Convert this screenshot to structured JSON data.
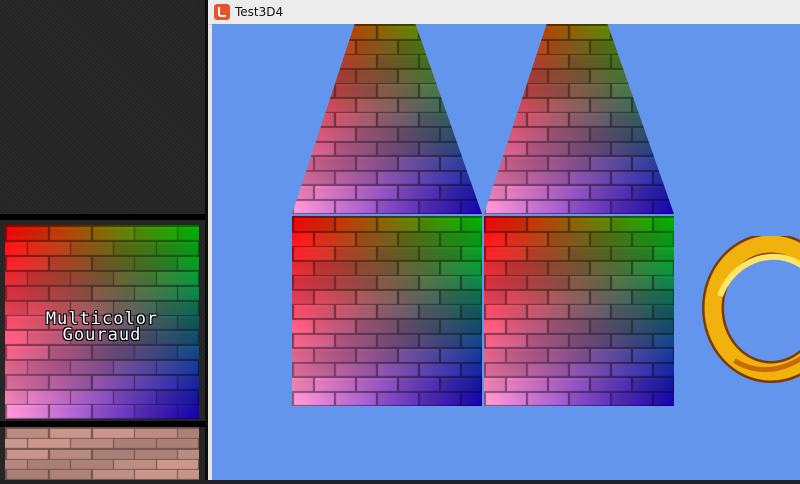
{
  "window": {
    "title": "Test3D4"
  },
  "texture_preview": {
    "label_line1": "Multicolor",
    "label_line2": "Gouraud"
  },
  "colors": {
    "viewport_background": "#6495ed",
    "gouraud_top_left": "#ff0000",
    "gouraud_top_right": "#00cc00",
    "gouraud_bottom_left": "#ff9ad6",
    "gouraud_bottom_right": "#1a00cc",
    "ring_gold": "#f2b20d"
  },
  "icons": {
    "app": "monogame-icon"
  }
}
